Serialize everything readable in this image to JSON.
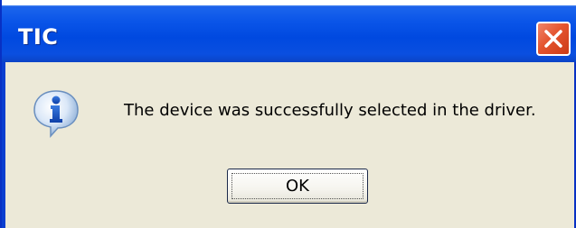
{
  "window": {
    "title": "TIC"
  },
  "titlebar": {
    "close_icon": "close-icon",
    "close_color": "#e4542f"
  },
  "dialog": {
    "icon": "info-icon",
    "message": "The device was successfully selected in the driver.",
    "ok_label": "OK"
  },
  "colors": {
    "titlebar": "#0049e0",
    "client_background": "#ece9d8"
  }
}
